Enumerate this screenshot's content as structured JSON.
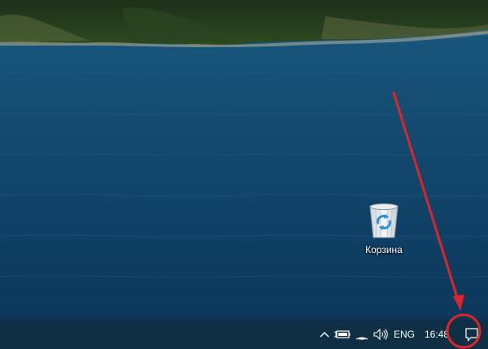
{
  "desktop": {
    "icons": [
      {
        "label": "Корзина",
        "icon": "recycle-bin-icon"
      }
    ]
  },
  "taskbar": {
    "tray": {
      "show_hidden_icon": "chevron-up-icon",
      "battery_icon": "battery-icon",
      "network_icon": "wifi-icon",
      "volume_icon": "speaker-icon",
      "language": "ENG",
      "time": "16:48",
      "notifications_icon": "action-center-icon"
    }
  },
  "annotation": {
    "type": "arrow-with-circle",
    "target": "notifications",
    "color": "#e0242a"
  },
  "colors": {
    "taskbar": "#0f2f44",
    "sea": "#0d3f63"
  }
}
